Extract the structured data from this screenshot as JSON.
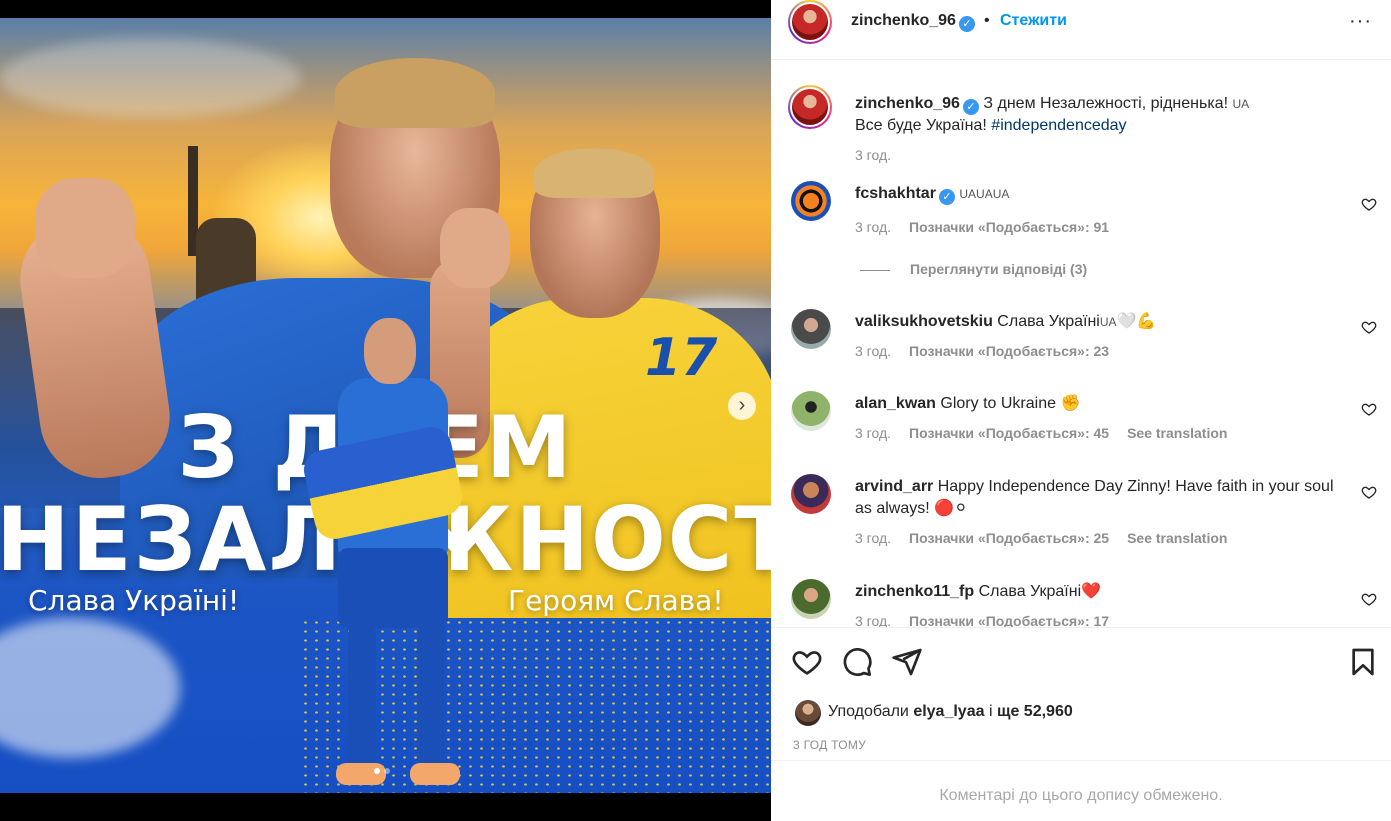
{
  "media": {
    "headline_line1": "З ДНЕМ",
    "headline_line2": "НЕЗАЛЕЖНОСТІ!",
    "slogan_left": "Слава Україні!",
    "slogan_right": "Героям Слава!",
    "player_number": "17",
    "next_icon": "chevron-right-icon",
    "carousel": {
      "count": 2,
      "active": 0
    }
  },
  "header": {
    "username": "zinchenko_96",
    "separator": "•",
    "follow_label": "Стежити",
    "more_label": "···"
  },
  "caption": {
    "username": "zinchenko_96",
    "text_line1": "З днем Незалежності, рідненька! ",
    "flag_text": "UA",
    "text_line2": "Все буде Україна! ",
    "hashtag": "#independenceday",
    "time": "3 год."
  },
  "comments": [
    {
      "username": "fcshakhtar",
      "verified": true,
      "text": "",
      "tiny": "UAUAUA",
      "time": "3 год.",
      "likes": "Позначки «Подобається»: 91",
      "translate": ""
    },
    {
      "username": "valiksukhovetskiu",
      "verified": false,
      "text": "Слава Україні",
      "tiny": "UA",
      "emoji": "🤍💪",
      "time": "3 год.",
      "likes": "Позначки «Подобається»: 23",
      "translate": ""
    },
    {
      "username": "alan_kwan",
      "verified": false,
      "text": "Glory to Ukraine ",
      "emoji": "✊",
      "time": "3 год.",
      "likes": "Позначки «Подобається»: 45",
      "translate": "See translation"
    },
    {
      "username": "arvind_arr",
      "verified": false,
      "text": "Happy Independence Day Zinny! Have faith in your soul as always! ",
      "emoji": "🔴⚪",
      "time": "3 год.",
      "likes": "Позначки «Подобається»: 25",
      "translate": "See translation"
    },
    {
      "username": "zinchenko11_fp",
      "verified": false,
      "text": "Слава Україні",
      "emoji": "❤️",
      "time": "3 год.",
      "likes": "Позначки «Подобається»: 17",
      "translate": ""
    }
  ],
  "replies_label": "Переглянути відповіді (3)",
  "likes": {
    "prefix": "Уподобали ",
    "user": "elya_lyaa",
    "middle": " і ",
    "count": "ще 52,960"
  },
  "posted": "3 ГОД ТОМУ",
  "restricted": "Коментарі до цього допису обмежено.",
  "colors": {
    "link": "#0095f6",
    "hashtag": "#00376b",
    "verified": "#3897f0",
    "muted": "#8e8e8e",
    "yellow": "#f7d33a",
    "blue": "#1c55c4"
  }
}
